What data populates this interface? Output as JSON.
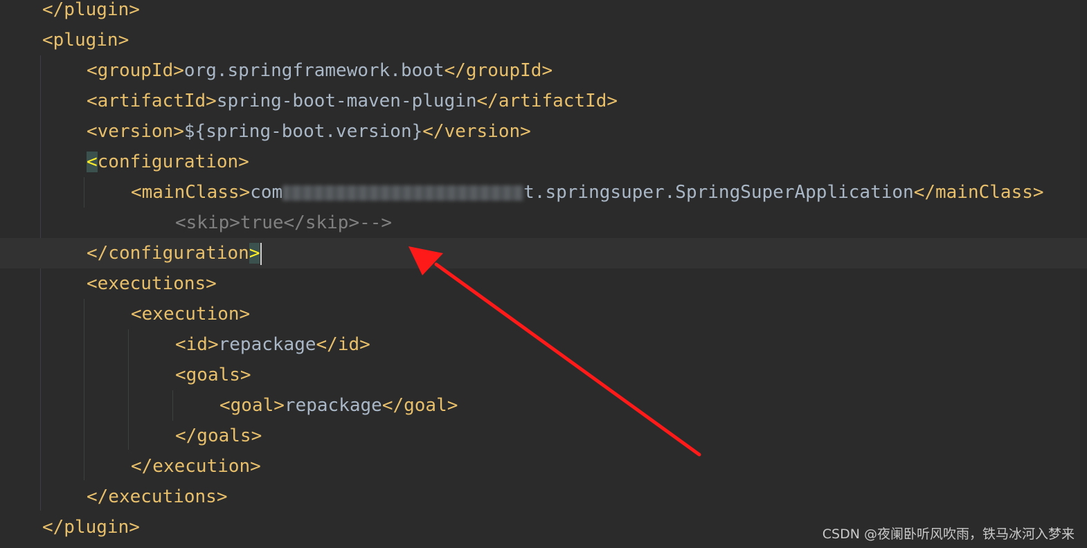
{
  "editor": {
    "lines": [
      {
        "open": "</plugin>"
      },
      {
        "open": "<plugin>"
      },
      {
        "open": "<groupId>",
        "text": "org.springframework.boot",
        "close": "</groupId>"
      },
      {
        "open": "<artifactId>",
        "text": "spring-boot-maven-plugin",
        "close": "</artifactId>"
      },
      {
        "open": "<version>",
        "text": "${spring-boot.version}",
        "close": "</version>"
      },
      {
        "bracket": "<",
        "open": "configuration>"
      },
      {
        "open": "<mainClass>",
        "text_start": "com",
        "text_end": "t.springsuper.SpringSuperApplication",
        "close": "</mainClass>"
      },
      {
        "comment": "<skip>true</skip>-->"
      },
      {
        "open": "</configuration",
        "bracket": ">"
      },
      {
        "open": "<executions>"
      },
      {
        "open": "<execution>"
      },
      {
        "open": "<id>",
        "text": "repackage",
        "close": "</id>"
      },
      {
        "open": "<goals>"
      },
      {
        "open": "<goal>",
        "text": "repackage",
        "close": "</goal>"
      },
      {
        "open": "</goals>"
      },
      {
        "open": "</execution>"
      },
      {
        "open": "</executions>"
      },
      {
        "open": "</plugin>"
      }
    ]
  },
  "annotation": {
    "arrow_color": "#ff1a1a"
  },
  "watermark": {
    "text": "CSDN @夜阑卧听风吹雨，铁马冰河入梦来"
  }
}
